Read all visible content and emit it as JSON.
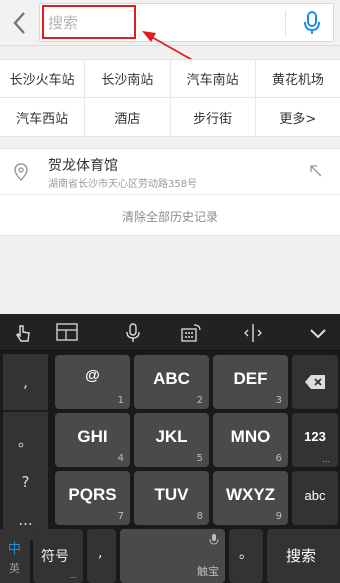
{
  "search": {
    "placeholder": "搜索",
    "back_icon": "chevron-left-icon",
    "mic_icon": "microphone-icon"
  },
  "hot": [
    [
      "长沙火车站",
      "长沙南站",
      "汽车南站",
      "黄花机场"
    ],
    [
      "汽车西站",
      "酒店",
      "步行街",
      "更多>"
    ]
  ],
  "history": {
    "name": "贺龙体育馆",
    "address": "湖南省长沙市天心区劳动路358号",
    "clear_label": "清除全部历史记录"
  },
  "keyboard": {
    "left_keys": [
      ",",
      "。",
      "?",
      "..."
    ],
    "keys": [
      {
        "main": "@",
        "sub": "1"
      },
      {
        "main": "ABC",
        "sub": "2"
      },
      {
        "main": "DEF",
        "sub": "3"
      },
      {
        "main": "GHI",
        "sub": "4"
      },
      {
        "main": "JKL",
        "sub": "5"
      },
      {
        "main": "MNO",
        "sub": "6"
      },
      {
        "main": "PQRS",
        "sub": "7"
      },
      {
        "main": "TUV",
        "sub": "8"
      },
      {
        "main": "WXYZ",
        "sub": "9"
      }
    ],
    "right_keys": {
      "num": "123",
      "abc": "abc"
    },
    "bottom": {
      "lang_top": "中",
      "lang_bottom": "英",
      "symbol": "符号",
      "comma": ",",
      "space_brand": "触宝",
      "period": "。",
      "search": "搜索"
    },
    "colors": {
      "accent": "#1e8fe0",
      "highlight": "#e01c1c"
    }
  }
}
